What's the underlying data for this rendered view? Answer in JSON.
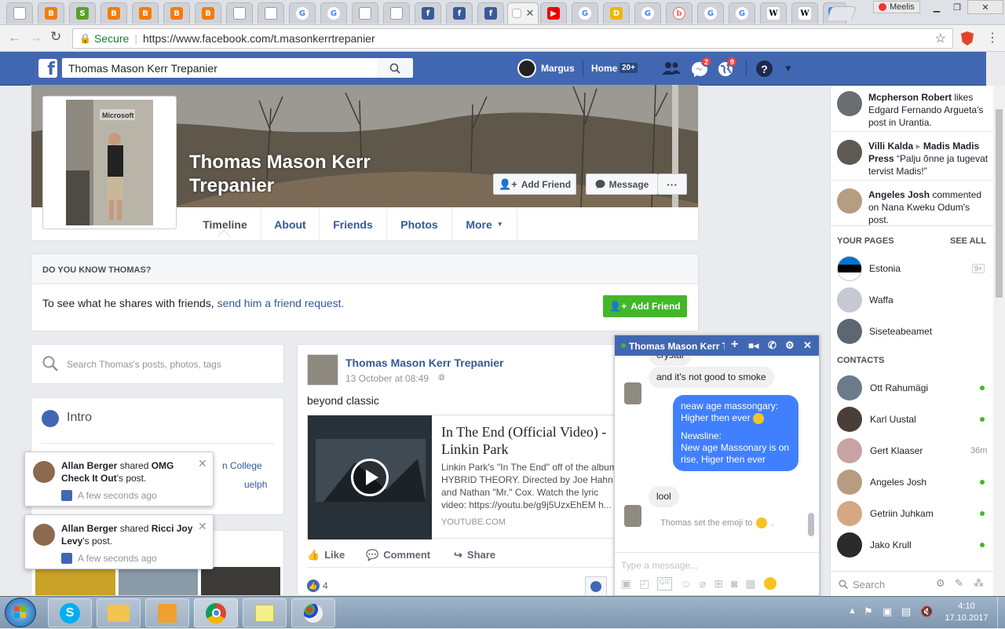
{
  "browser": {
    "user_label": "Meelis",
    "address": {
      "secure_label": "Secure",
      "url": "https://www.facebook.com/t.masonkerrtrepanier"
    }
  },
  "fb_header": {
    "search_value": "Thomas Mason Kerr Trepanier",
    "user_name": "Margus",
    "home_label": "Home",
    "home_badge": "20+",
    "messages_badge": "2",
    "notifications_badge": "9"
  },
  "profile": {
    "name_line1": "Thomas Mason Kerr",
    "name_line2": "Trepanier",
    "add_friend_label": "Add Friend",
    "message_label": "Message",
    "more_label": "···",
    "tabs": [
      {
        "label": "Timeline"
      },
      {
        "label": "About"
      },
      {
        "label": "Friends"
      },
      {
        "label": "Photos"
      },
      {
        "label": "More"
      }
    ]
  },
  "know_box": {
    "heading": "DO YOU KNOW THOMAS?",
    "text": "To see what he shares with friends, ",
    "link": "send him a friend request.",
    "button": "Add Friend"
  },
  "left_col": {
    "search_placeholder": "Search Thomas's posts, photos, tags",
    "intro_title": "Intro",
    "intro_partial_1": "n College",
    "intro_partial_2": "uelph"
  },
  "post": {
    "author": "Thomas Mason Kerr Trepanier",
    "timestamp": "13 October at 08:49",
    "text": "beyond classic",
    "link_title": "In The End (Official Video) - Linkin Park",
    "link_desc": "Linkin Park's \"In The End\" off of the album HYBRID THEORY. Directed by Joe Hahn and Nathan \"Mr.\" Cox. Watch the lyric video: https://youtu.be/g9j5UzxEhEM h...",
    "link_domain": "YOUTUBE.COM",
    "like_label": "Like",
    "comment_label": "Comment",
    "share_label": "Share",
    "reaction_count": "4"
  },
  "chat": {
    "title": "Thomas Mason Kerr T",
    "msg_top_partial": "crystal",
    "msg1": "and it's not good to smoke",
    "msg2_line1": "neaw age massongary:",
    "msg2_line2": "Higher then ever",
    "msg2_line3": "Newsline:",
    "msg2_line4": "New age Massonary is on rise, Higer then ever",
    "msg3": "lool",
    "system_msg": "Thomas set the emoji to",
    "input_placeholder": "Type a message..."
  },
  "notifications": [
    {
      "actor": "Allan Berger",
      "verb": " shared ",
      "object": "OMG Check It Out",
      "suffix": "'s post.",
      "time": "A few seconds ago"
    },
    {
      "actor": "Allan Berger",
      "verb": " shared ",
      "object": "Ricci Joy Levy",
      "suffix": "'s post.",
      "time": "A few seconds ago"
    }
  ],
  "ticker": [
    {
      "actor": "Mcpherson Robert",
      "text": " likes Edgard Fernando Argueta's post in Urantia."
    },
    {
      "actor": "Villi Kalda",
      "arrow": "▸",
      "target": "Madis Madis Press",
      "text": " “Palju õnne ja tugevat tervist Madis!”"
    },
    {
      "actor": "Angeles Josh",
      "text": " commented on Nana Kweku Odum's post."
    }
  ],
  "your_pages": {
    "heading": "YOUR PAGES",
    "see_all": "SEE ALL",
    "items": [
      {
        "name": "Estonia",
        "badge": "9+"
      },
      {
        "name": "Waffa"
      },
      {
        "name": "Siseteabeamet"
      }
    ]
  },
  "contacts": {
    "heading": "CONTACTS",
    "items": [
      {
        "name": "Ott Rahumägi",
        "status": "online"
      },
      {
        "name": "Karl Uustal",
        "status": "online"
      },
      {
        "name": "Gert Klaaser",
        "status": "36m"
      },
      {
        "name": "Angeles Josh",
        "status": "online"
      },
      {
        "name": "Getriin Juhkam",
        "status": "online"
      },
      {
        "name": "Jako Krull",
        "status": "online"
      }
    ],
    "search_placeholder": "Search"
  },
  "taskbar": {
    "time": "4:10",
    "date": "17.10.2017"
  },
  "colors": {
    "fb_blue": "#4267b2",
    "green": "#42b72a",
    "link": "#365899"
  }
}
